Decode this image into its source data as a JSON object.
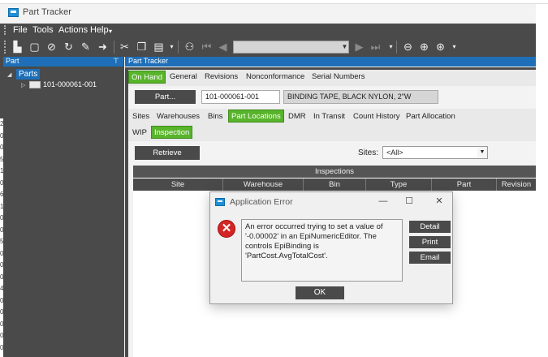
{
  "window": {
    "title": "Part Tracker"
  },
  "menu": {
    "items": [
      "File",
      "Tools",
      "Actions",
      "Help"
    ]
  },
  "toolbar": {
    "icons": [
      "new-icon",
      "save-icon",
      "attach-icon",
      "refresh-icon",
      "clear-icon",
      "navigate-icon",
      "cut-icon",
      "copy-icon",
      "paste-icon",
      "search-binoculars-icon",
      "first-record-icon",
      "previous-record-icon",
      "next-record-icon",
      "last-record-icon",
      "back-icon",
      "forward-icon",
      "home-icon"
    ]
  },
  "left_panel": {
    "header": "Part",
    "tree": {
      "root": "Parts",
      "child": "101-000061-001"
    }
  },
  "main": {
    "header": "Part Tracker",
    "top_tabs": [
      "On Hand",
      "General",
      "Revisions",
      "Nonconformance",
      "Serial Numbers"
    ],
    "active_top_tab": "On Hand",
    "part_button": "Part...",
    "part_number": "101-000061-001",
    "part_description": "BINDING TAPE, BLACK NYLON, 2\"W",
    "sub_tabs": [
      "Sites",
      "Warehouses",
      "Bins",
      "Part Locations",
      "DMR",
      "In Transit",
      "Count History",
      "Part Allocation"
    ],
    "active_sub_tab": "Part Locations",
    "sub_sub_tabs": [
      "WIP",
      "Inspection"
    ],
    "active_sub_sub_tab": "Inspection",
    "retrieve_button": "Retrieve",
    "sites_label": "Sites:",
    "sites_value": "<All>",
    "grid": {
      "band": "Inspections",
      "columns": [
        "Site",
        "Warehouse",
        "Bin",
        "Type",
        "Part",
        "Revision"
      ]
    }
  },
  "dialog": {
    "title": "Application Error",
    "message": "An error occurred trying to set a value of '-0.00002' in an EpiNumericEditor. The controls EpiBinding is 'PartCost.AvgTotalCost'.",
    "buttons": {
      "detail": "Detail",
      "print": "Print",
      "email": "Email",
      "ok": "OK"
    }
  },
  "edge_digits": [
    "2",
    "0",
    "0",
    "5",
    "1",
    "0",
    "6",
    "1",
    "0",
    "0",
    "5",
    "0",
    "0",
    "0",
    "4",
    "0",
    "0",
    "0",
    "0",
    "0"
  ]
}
